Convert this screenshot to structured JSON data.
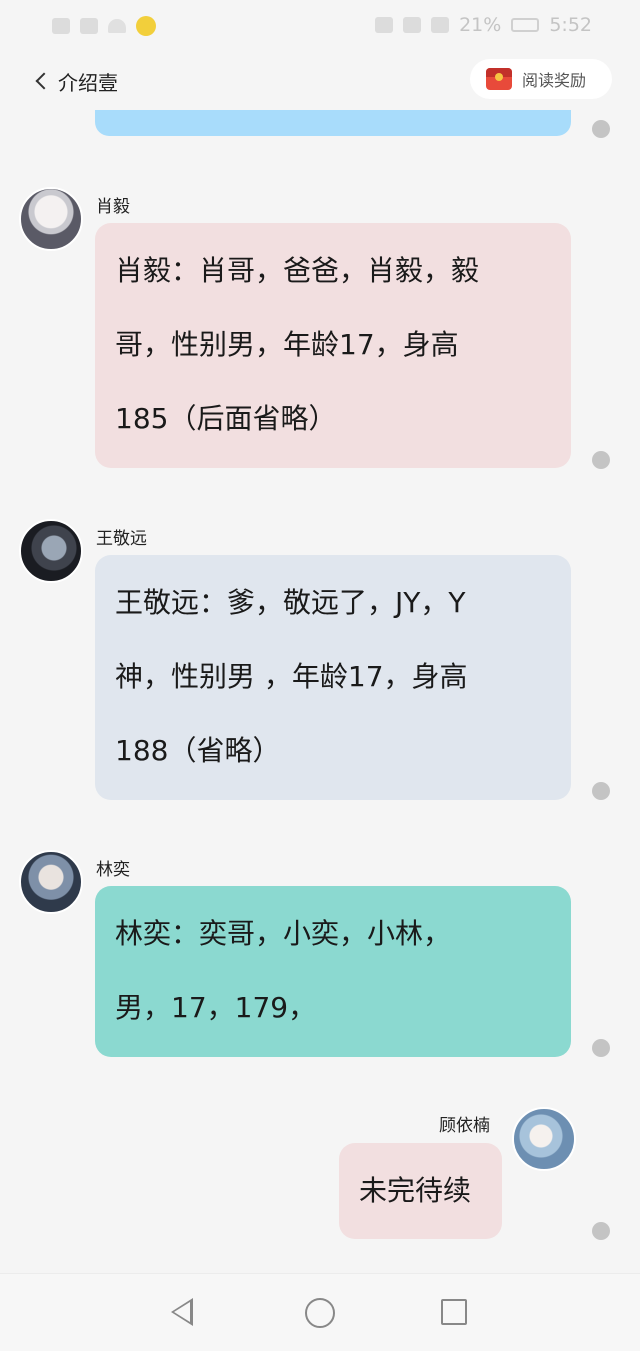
{
  "status_bar": {
    "battery": "21%",
    "time": "5:52"
  },
  "header": {
    "back_label": "介绍壹",
    "reward_label": "阅读奖励",
    "reward_icon": "red-envelope-icon"
  },
  "messages": [
    {
      "sender": "肖毅",
      "lines": [
        "肖毅：肖哥，爸爸，肖毅，毅",
        "哥，性别男，年龄17，身高",
        "185（后面省略）"
      ],
      "color": "#f2dfe0"
    },
    {
      "sender": "王敬远",
      "lines": [
        "王敬远：爹，敬远了，JY，Y",
        "神，性别男 ，年龄17，身高",
        "188（省略）"
      ],
      "color": "#e0e6ee"
    },
    {
      "sender": "林奕",
      "lines": [
        "林奕：奕哥，小奕，小林，",
        "男，17，179，"
      ],
      "color": "#8bd9d0"
    },
    {
      "sender": "顾依楠",
      "lines": [
        "未完待续"
      ],
      "color": "#f2dfe0"
    }
  ]
}
